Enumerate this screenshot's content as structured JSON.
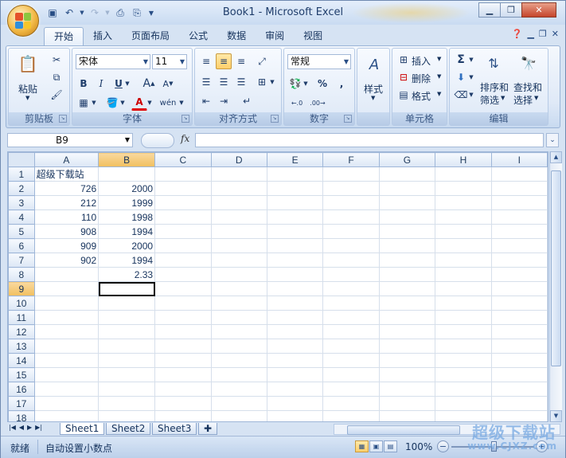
{
  "window": {
    "title": "Book1 - Microsoft Excel"
  },
  "colors": {
    "accent": "#f1bf5f",
    "ribbon": "#dfe9f7",
    "title_bg": "#c9dbf1"
  },
  "ribbon": {
    "tabs": [
      "开始",
      "插入",
      "页面布局",
      "公式",
      "数据",
      "审阅",
      "视图"
    ],
    "active_tab": "开始",
    "clipboard": {
      "paste": "粘贴",
      "label": "剪贴板"
    },
    "font": {
      "name": "宋体",
      "size": "11",
      "label": "字体"
    },
    "alignment": {
      "label": "对齐方式"
    },
    "number": {
      "format": "常规",
      "percent": "%",
      "comma": ",",
      "label": "数字"
    },
    "styles": {
      "label": "样式"
    },
    "cells": {
      "insert": "插入",
      "delete": "删除",
      "format": "格式",
      "label": "单元格"
    },
    "editing": {
      "sum": "Σ",
      "sort": "排序和\n筛选",
      "find": "查找和\n选择",
      "sort_line1": "排序和",
      "sort_line2": "筛选",
      "find_line1": "查找和",
      "find_line2": "选择",
      "label": "编辑"
    }
  },
  "formula_bar": {
    "name_box": "B9",
    "fx": "fx",
    "formula": ""
  },
  "grid": {
    "columns": [
      "A",
      "B",
      "C",
      "D",
      "E",
      "F",
      "G",
      "H",
      "I"
    ],
    "rows": [
      [
        "超级下载站",
        "",
        "",
        "",
        "",
        "",
        "",
        "",
        ""
      ],
      [
        "726",
        "2000",
        "",
        "",
        "",
        "",
        "",
        "",
        ""
      ],
      [
        "212",
        "1999",
        "",
        "",
        "",
        "",
        "",
        "",
        ""
      ],
      [
        "110",
        "1998",
        "",
        "",
        "",
        "",
        "",
        "",
        ""
      ],
      [
        "908",
        "1994",
        "",
        "",
        "",
        "",
        "",
        "",
        ""
      ],
      [
        "909",
        "2000",
        "",
        "",
        "",
        "",
        "",
        "",
        ""
      ],
      [
        "902",
        "1994",
        "",
        "",
        "",
        "",
        "",
        "",
        ""
      ],
      [
        "",
        "2.33",
        "",
        "",
        "",
        "",
        "",
        "",
        ""
      ],
      [
        "",
        "",
        "",
        "",
        "",
        "",
        "",
        "",
        ""
      ],
      [
        "",
        "",
        "",
        "",
        "",
        "",
        "",
        "",
        ""
      ],
      [
        "",
        "",
        "",
        "",
        "",
        "",
        "",
        "",
        ""
      ],
      [
        "",
        "",
        "",
        "",
        "",
        "",
        "",
        "",
        ""
      ],
      [
        "",
        "",
        "",
        "",
        "",
        "",
        "",
        "",
        ""
      ],
      [
        "",
        "",
        "",
        "",
        "",
        "",
        "",
        "",
        ""
      ],
      [
        "",
        "",
        "",
        "",
        "",
        "",
        "",
        "",
        ""
      ],
      [
        "",
        "",
        "",
        "",
        "",
        "",
        "",
        "",
        ""
      ],
      [
        "",
        "",
        "",
        "",
        "",
        "",
        "",
        "",
        ""
      ],
      [
        "",
        "",
        "",
        "",
        "",
        "",
        "",
        "",
        ""
      ]
    ],
    "row_numbers": [
      "1",
      "2",
      "3",
      "4",
      "5",
      "6",
      "7",
      "8",
      "9",
      "10",
      "11",
      "12",
      "13",
      "14",
      "15",
      "16",
      "17",
      "18"
    ],
    "selected_cell": "B9"
  },
  "sheets": {
    "tabs": [
      "Sheet1",
      "Sheet2",
      "Sheet3"
    ],
    "active": "Sheet1"
  },
  "status": {
    "ready": "就绪",
    "mode": "自动设置小数点",
    "zoom": "100%"
  },
  "watermark": {
    "line1": "超级下载站",
    "line2": "www.CJXZ.com"
  }
}
